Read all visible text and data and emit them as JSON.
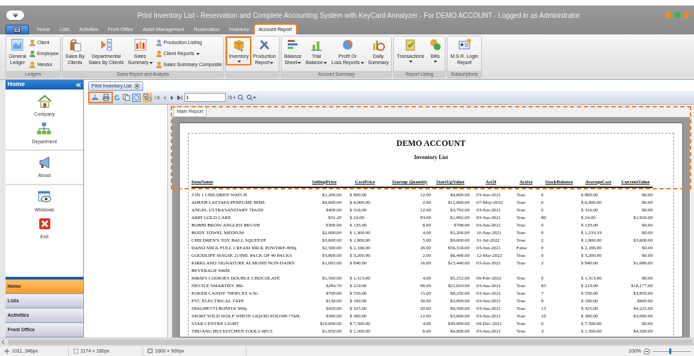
{
  "window": {
    "title": "Print Inventory List - Reservation and Complete Accounting System with KeyCard Annalyzer - For DEMO ACCOUNT - Logged in as Administrator"
  },
  "tabs": [
    {
      "label": "Home",
      "selected": false,
      "highlighted": false
    },
    {
      "label": "Lists",
      "selected": false,
      "highlighted": false
    },
    {
      "label": "Activities",
      "selected": false,
      "highlighted": false
    },
    {
      "label": "Front Office",
      "selected": false,
      "highlighted": false
    },
    {
      "label": "Asset Management",
      "selected": false,
      "highlighted": false
    },
    {
      "label": "Reservation",
      "selected": false,
      "highlighted": false
    },
    {
      "label": "Inventory",
      "selected": false,
      "highlighted": false
    },
    {
      "label": "Account Report",
      "selected": true,
      "highlighted": true
    }
  ],
  "ribbon": {
    "groups": [
      {
        "label": "Ledgers",
        "items": [
          {
            "kind": "large",
            "label": "General\nLedger",
            "dropdown": false,
            "highlighted": false
          },
          {
            "kind": "small",
            "label": "Client",
            "dropdown": false,
            "highlighted": false
          },
          {
            "kind": "small",
            "label": "Employee",
            "dropdown": false,
            "highlighted": false
          },
          {
            "kind": "small",
            "label": "Vendor",
            "dropdown": false,
            "highlighted": false
          }
        ]
      },
      {
        "label": "Sales Report and Analysis",
        "items": [
          {
            "kind": "large",
            "label": "Sales By\nClients",
            "dropdown": false,
            "highlighted": false
          },
          {
            "kind": "large",
            "label": "Departmental\nSales By Clients",
            "dropdown": false,
            "highlighted": false
          },
          {
            "kind": "large",
            "label": "Sales\nSummary",
            "dropdown": true,
            "highlighted": false
          },
          {
            "kind": "small",
            "label": "Production Listing",
            "dropdown": false,
            "highlighted": false
          },
          {
            "kind": "small",
            "label": "Client Reports",
            "dropdown": true,
            "highlighted": false
          },
          {
            "kind": "small",
            "label": "Sales Summary Composite",
            "dropdown": false,
            "highlighted": false
          }
        ]
      },
      {
        "items": [
          {
            "kind": "large",
            "label": "Inventory",
            "dropdown": true,
            "highlighted": true
          },
          {
            "kind": "large",
            "label": "Production\nReport",
            "dropdown": true,
            "highlighted": false
          }
        ]
      },
      {
        "label": "Account Summary",
        "items": [
          {
            "kind": "large",
            "label": "Balance\nSheet",
            "dropdown": true,
            "highlighted": false
          },
          {
            "kind": "large",
            "label": "Trial\nBalance",
            "dropdown": true,
            "highlighted": false
          },
          {
            "kind": "large",
            "label": "Profit Or\nLoss Reports",
            "dropdown": true,
            "highlighted": false
          },
          {
            "kind": "large",
            "label": "Daily\nSummary",
            "dropdown": false,
            "highlighted": false
          }
        ]
      },
      {
        "label": "Report Listing",
        "items": [
          {
            "kind": "large",
            "label": "Transactions",
            "dropdown": true,
            "highlighted": false
          },
          {
            "kind": "large",
            "label": "Bills",
            "dropdown": true,
            "highlighted": false
          }
        ]
      },
      {
        "label": "Subscriptions",
        "items": [
          {
            "kind": "large",
            "label": "M.S.R. Login\nReport",
            "dropdown": false,
            "highlighted": false
          }
        ]
      }
    ]
  },
  "sidebar": {
    "title": "Home",
    "sections": [
      {
        "items": [
          {
            "label": "Company"
          },
          {
            "label": "Department"
          }
        ]
      },
      {
        "items": [
          {
            "label": "About"
          }
        ]
      },
      {
        "items": [
          {
            "label": "Windows"
          },
          {
            "label": "Exit"
          }
        ]
      }
    ],
    "nav": [
      {
        "label": "Home",
        "selected": true
      },
      {
        "label": "Lists",
        "selected": false
      },
      {
        "label": "Activities",
        "selected": false
      },
      {
        "label": "Front Office",
        "selected": false
      }
    ]
  },
  "document_tab": {
    "label": "Print Inventory List"
  },
  "toolbar": {
    "print_buttons_highlighted": true,
    "page": "1",
    "page_count": "/1+"
  },
  "report": {
    "tab": "Main Report",
    "header_highlighted": true,
    "title": "DEMO ACCOUNT",
    "subtitle": "Inventory List",
    "columns": [
      "ItemName",
      "SellingPrice",
      "CostPrice",
      "Startup Quantity",
      "StartUpValue",
      "AsOf",
      "Active",
      "StockBalance",
      "AverageCost",
      "CurrentValue"
    ],
    "rows": [
      [
        "3 IN 1 CHILDREN WATCH",
        "$1,200.00",
        "$ 800.00",
        "12.00",
        "$9,600.00",
        "03-Jun-2021",
        "True",
        "0",
        "$ 800.00",
        "$0.00"
      ],
      [
        "ADEEB LATTAFA PERFUME 80ML",
        "$9,000.00",
        "$ 6,000.00",
        "2.00",
        "$12,000.00",
        "07-May-2022",
        "True",
        "0",
        "$ 6,000.00",
        "$0.00"
      ],
      [
        "ANGEL ULTRASANITARY  7PADS",
        "$400.00",
        "$ 316.00",
        "12.00",
        "$3,792.00",
        "03-Jun-2021",
        "True",
        "0",
        "$ 316.00",
        "$0.00"
      ],
      [
        "ARPI GOLD CARE",
        "$31.20",
        "$ 24.00",
        "83.00",
        "$1,992.00",
        "03-Jun-2021",
        "True",
        "80",
        "$ 24.00",
        "$1,920.00"
      ],
      [
        "BOBBI BROW ANGLED BRUSH",
        "$300.00",
        "$ 133.00",
        "6.00",
        "$798.00",
        "03-Jun-2021",
        "True",
        "0",
        "$ 133.00",
        "$0.00"
      ],
      [
        "BODY TOWEL MEDIUM",
        "$2,000.00",
        "$ 1,300.00",
        "4.00",
        "$5,200.00",
        "10-Sep-2021",
        "True",
        "0",
        "$ 1,233.33",
        "$0.00"
      ],
      [
        "CHILDREN'S TOY BALL SQUEEZE",
        "$3,000.00",
        "$ 1,800.00",
        "5.00",
        "$9,000.00",
        "31-Jul-2022",
        "True",
        "2",
        "$ 1,800.00",
        "$3,600.00"
      ],
      [
        "DANO MILK FULL CREAM MILK POWDRE-800g",
        "$2,500.00",
        "$ 2,166.00",
        "26.00",
        "$56,316.00",
        "03-Jun-2021",
        "False",
        "0",
        "$ 2,166.00",
        "$0.00"
      ],
      [
        "GOODLIFE MAGIK 21SML PACK OF 40 PACKS",
        "$3,800.00",
        "$ 3,200.00",
        "2.00",
        "$6,400.00",
        "12-Mar-2022",
        "True",
        "0",
        "$ 3,200.00",
        "$0.00"
      ],
      [
        "KIRKLAND SIGNATURE ALMOND NON-DAIRY BEVERAGE 946M",
        "$1,092.00",
        "$ 840.00",
        "16.00",
        "$13,440.00",
        "03-Jun-2021",
        "True",
        "2",
        "$ 840.00",
        "$1,680.00"
      ],
      [
        "M&M'S COOKIES DOUBLE CHOCOLATE",
        "$1,500.00",
        "$ 1,313.00",
        "4.00",
        "$5,252.00",
        "09-Feb-2022",
        "True",
        "0",
        "$ 1,313.00",
        "$0.00"
      ],
      [
        "NESTLE SMARTIES 38G",
        "$284.70",
        "$ 219.00",
        "96.00",
        "$21,024.00",
        "03-Jun-2021",
        "True",
        "83",
        "$ 219.00",
        "$18,177.00"
      ],
      [
        "POKER CANDY 70PIECES  4.5G",
        "$700.00",
        "$ 550.00",
        "15.00",
        "$8,250.00",
        "03-Jun-2021",
        "True",
        "7",
        "$ 550.00",
        "$3,850.00"
      ],
      [
        "PVC ELECTRICAL TAPE",
        "$130.00",
        "$ 100.00",
        "30.00",
        "$3,000.00",
        "03-Jun-2021",
        "True",
        "9",
        "$ 100.00",
        "$900.00"
      ],
      [
        "SPAGHETTI BONITA 500g",
        "$420.00",
        "$ 325.00",
        "20.00",
        "$6,500.00",
        "03-Jun-2021",
        "True",
        "13",
        "$ 325.00",
        "$4,225.00"
      ],
      [
        "SPORT WILD WOLF WHITE LIQUID POLISH-75ML",
        "$390.00",
        "$ 300.00",
        "12.00",
        "$3,600.00",
        "03-Jun-2021",
        "True",
        "10",
        "$ 300.00",
        "$3,000.00"
      ],
      [
        "STAR CENTRE LIGHT",
        "$10,000.00",
        "$ 7,500.00",
        "4.00",
        "$30,000.00",
        "04-Dec-2021",
        "True",
        "0",
        "$ 7,500.00",
        "$0.00"
      ],
      [
        "THUANG HUI KITCHEN TOOLS 6PCS",
        "$1,950.00",
        "$ 1,500.00",
        "6.00",
        "$9,000.00",
        "03-Jun-2021",
        "True",
        "3",
        "$ 1,500.00",
        "$4,500.00"
      ]
    ]
  },
  "status_bar": {
    "cursor": "1011, 346px",
    "selection": "1174 × 180px",
    "screen": "1600 × 900px",
    "zoom": "100%",
    "zoom_slider": {
      "level": 0.45
    }
  }
}
